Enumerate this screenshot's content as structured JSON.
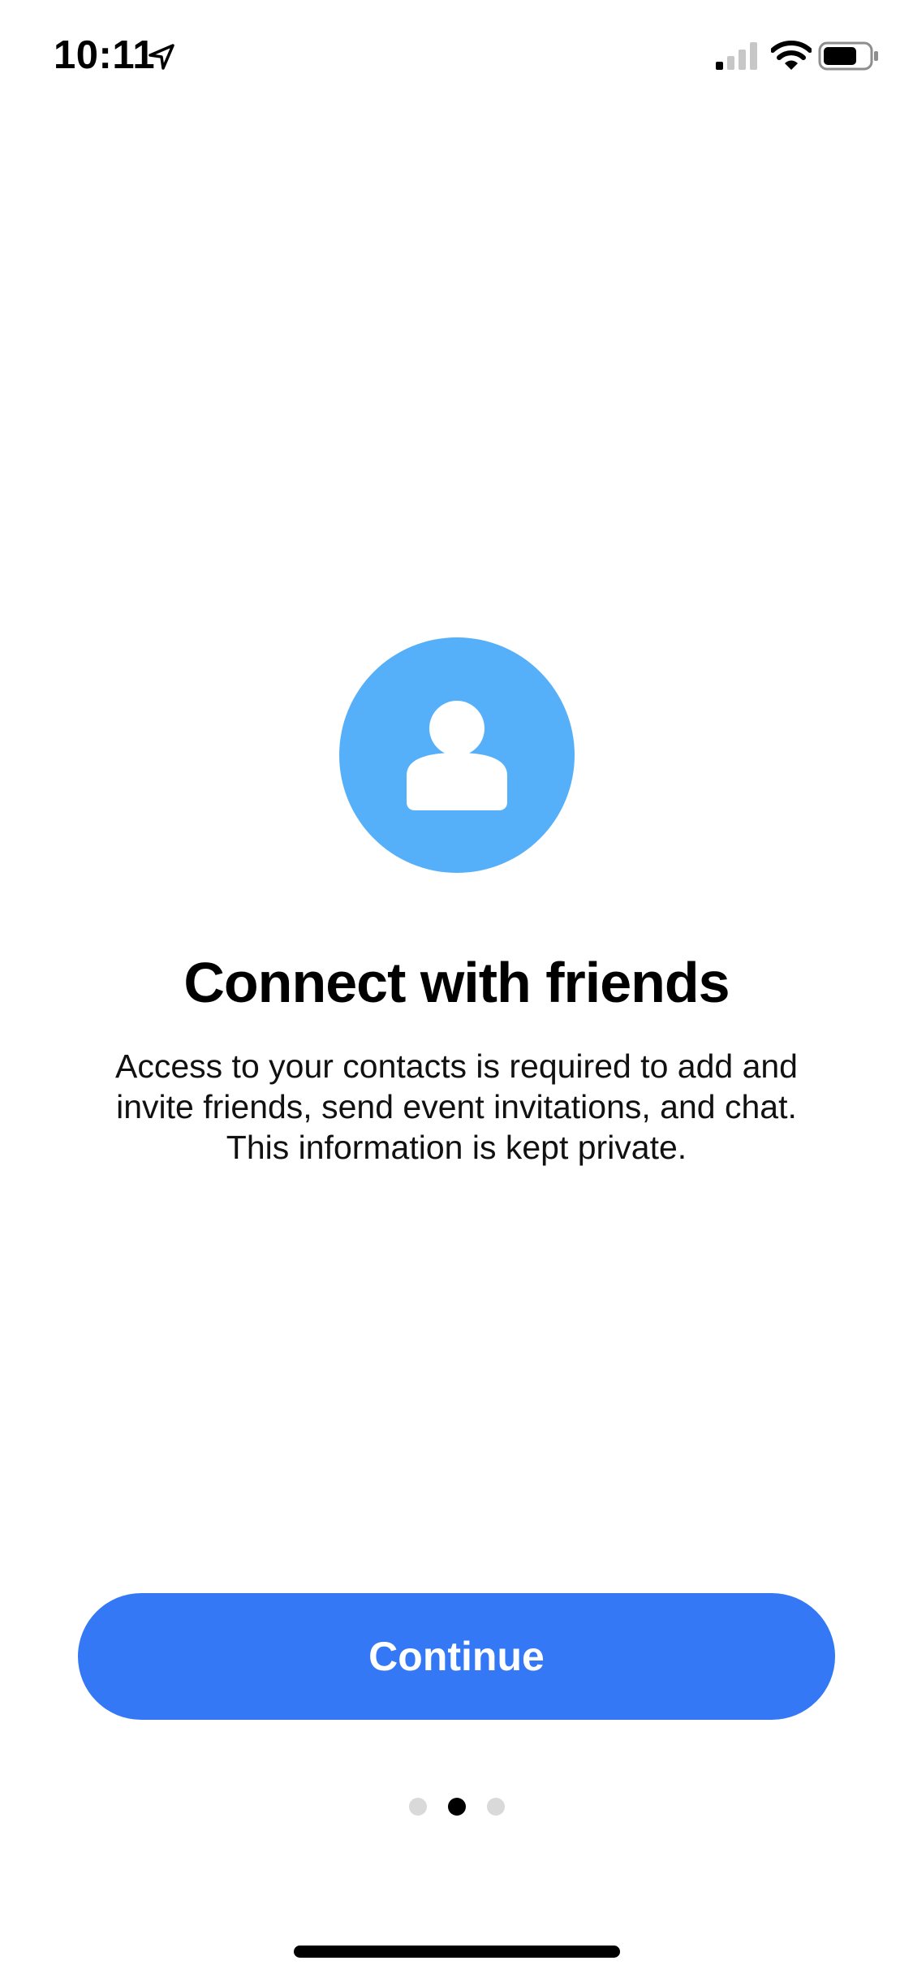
{
  "status_bar": {
    "time": "10:11",
    "icons": [
      "location-arrow-icon",
      "signal-icon",
      "wifi-icon",
      "battery-icon"
    ]
  },
  "hero": {
    "icon": "person-icon",
    "circle_color": "#55B0F9"
  },
  "content": {
    "title": "Connect with friends",
    "description_lines": [
      "Access to your contacts is required to add and",
      "invite friends, send event invitations, and chat.",
      "This information is kept private."
    ]
  },
  "actions": {
    "continue_label": "Continue",
    "button_color": "#3478F6"
  },
  "pagination": {
    "total": 3,
    "current": 2
  }
}
